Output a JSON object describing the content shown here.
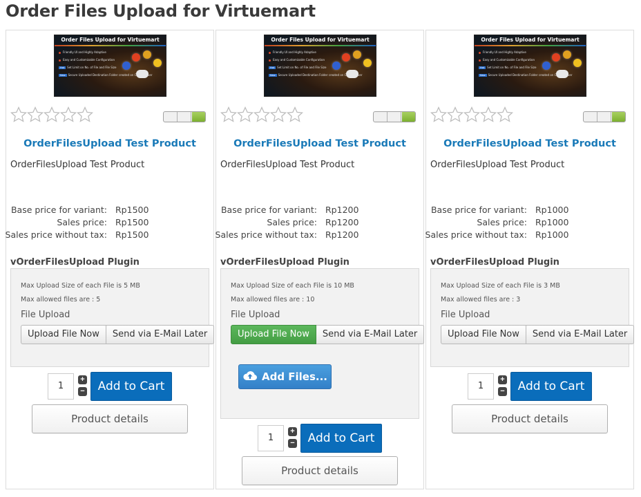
{
  "page": {
    "title": "Order Files Upload for Virtuemart"
  },
  "thumbnail": {
    "title": "Order Files Upload for Virtuemart",
    "lines": [
      "Friendly UI and Highly Adaptive",
      "Easy and Customizable Configuration",
      "Set Limit on No. of File and File Size",
      "Secure Uploaded Destination Folder created on Client Server"
    ],
    "badges": [
      "Hot",
      "New"
    ]
  },
  "labels": {
    "product_link": "OrderFilesUpload Test Product",
    "product_desc": "OrderFilesUpload Test Product",
    "base_price": "Base price for variant:",
    "sales_price": "Sales price:",
    "sales_no_tax": "Sales price without tax:",
    "plugin_title": "vOrderFilesUpload Plugin",
    "file_upload": "File Upload",
    "upload_now": "Upload File Now",
    "send_later": "Send via E-Mail Later",
    "add_files": "Add Files...",
    "add_to_cart": "Add to Cart",
    "product_details": "Product details",
    "qty_plus": "+",
    "qty_minus": "−"
  },
  "products": [
    {
      "base_price": "Rp1500",
      "sales_price": "Rp1500",
      "sales_no_tax": "Rp1500",
      "max_size": "Max Upload Size of each File is 5 MB",
      "max_files": "Max allowed files are : 5",
      "quantity": "1",
      "upload_now_active": false,
      "rating": 0
    },
    {
      "base_price": "Rp1200",
      "sales_price": "Rp1200",
      "sales_no_tax": "Rp1200",
      "max_size": "Max Upload Size of each File is 10 MB",
      "max_files": "Max allowed files are : 10",
      "quantity": "1",
      "upload_now_active": true,
      "rating": 0
    },
    {
      "base_price": "Rp1000",
      "sales_price": "Rp1000",
      "sales_no_tax": "Rp1000",
      "max_size": "Max Upload Size of each File is 3 MB",
      "max_files": "Max allowed files are : 3",
      "quantity": "1",
      "upload_now_active": false,
      "rating": 0
    }
  ],
  "colors": {
    "link": "#1a7ab8",
    "cart": "#0a6dbb",
    "active_green": "#5cb85c",
    "add_files_blue": "#3380c8",
    "toggle_green": "#8cc040"
  }
}
